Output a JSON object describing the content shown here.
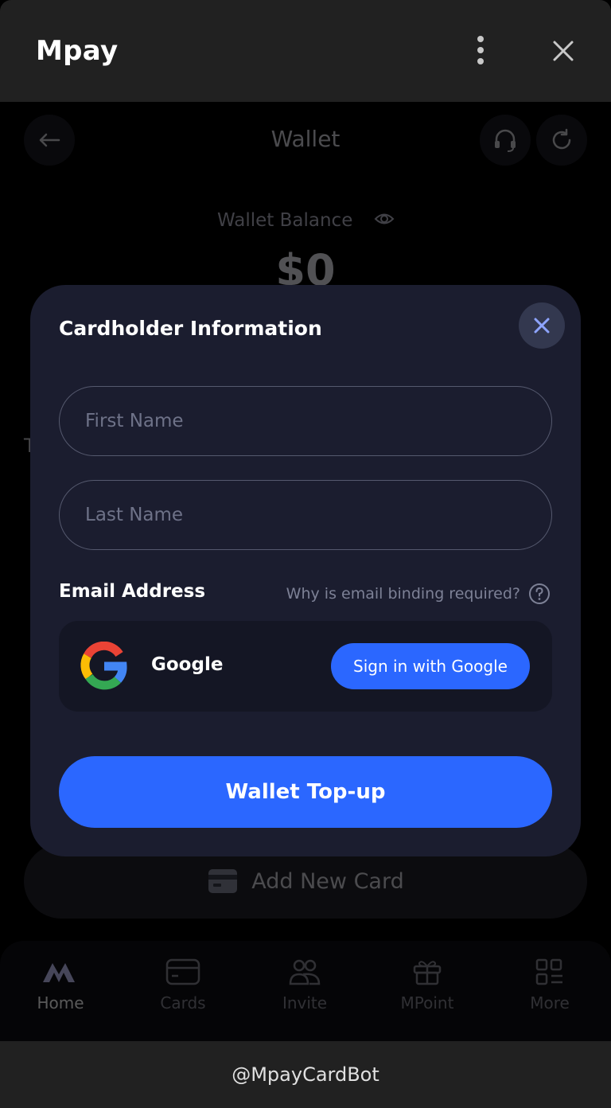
{
  "window": {
    "title": "Mpay",
    "more_icon": "vertical-dots-icon",
    "close_icon": "close-icon"
  },
  "header": {
    "title": "Wallet",
    "back_icon": "arrow-left-icon",
    "support_icon": "headset-icon",
    "refresh_icon": "refresh-icon"
  },
  "balance": {
    "label": "Wallet Balance",
    "value": "$0",
    "eye_icon": "eye-icon"
  },
  "background": {
    "partial_text": "T",
    "add_card_label": "Add New Card",
    "add_card_icon": "card-icon"
  },
  "bottom_nav": {
    "items": [
      {
        "label": "Home",
        "icon": "mpay-logo-icon",
        "active": true
      },
      {
        "label": "Cards",
        "icon": "card-icon",
        "active": false
      },
      {
        "label": "Invite",
        "icon": "users-icon",
        "active": false
      },
      {
        "label": "MPoint",
        "icon": "gift-icon",
        "active": false
      },
      {
        "label": "More",
        "icon": "grid-icon",
        "active": false
      }
    ]
  },
  "modal": {
    "title": "Cardholder Information",
    "first_name_placeholder": "First Name",
    "first_name_value": "",
    "last_name_placeholder": "Last Name",
    "last_name_value": "",
    "email_label": "Email Address",
    "why_link": "Why is email binding required?",
    "google_label": "Google",
    "google_button": "Sign in with Google",
    "submit_button": "Wallet Top-up"
  },
  "footer": {
    "text": "@MpayCardBot"
  },
  "colors": {
    "accent": "#2b67ff",
    "modal_bg": "#1b1d2f",
    "chrome_bg": "#212121"
  }
}
